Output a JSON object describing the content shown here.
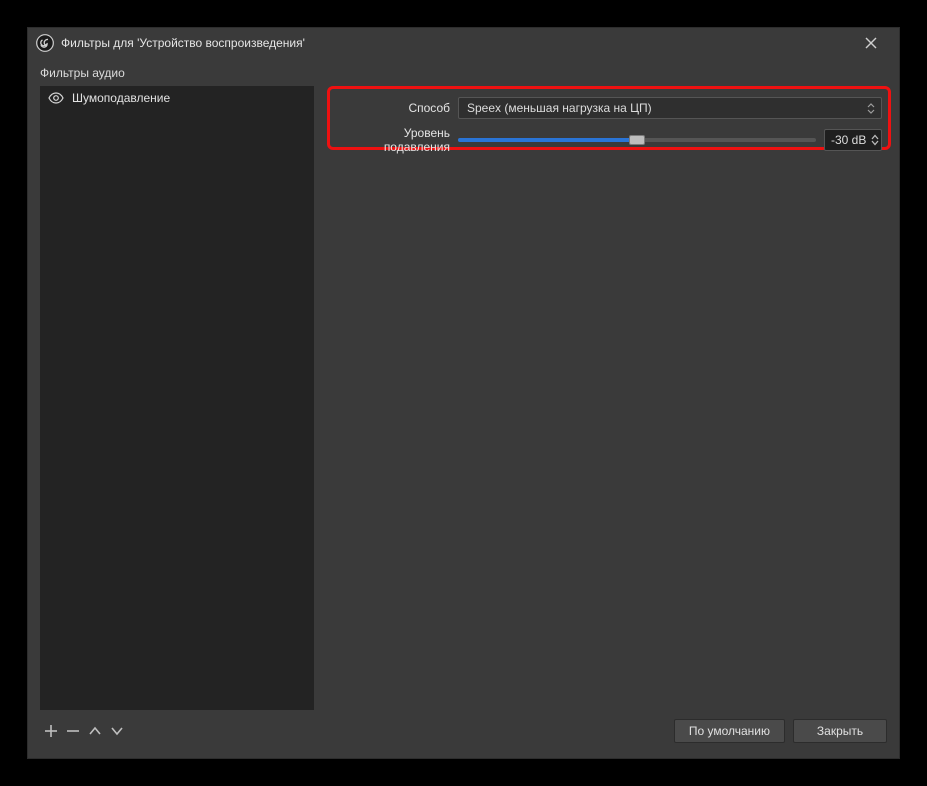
{
  "titlebar": {
    "title": "Фильтры для 'Устройство воспроизведения'"
  },
  "section": {
    "label": "Фильтры аудио"
  },
  "filters": {
    "items": [
      {
        "name": "Шумоподавление",
        "visible": true
      }
    ]
  },
  "properties": {
    "method": {
      "label": "Способ",
      "value": "Speex (меньшая нагрузка на ЦП)"
    },
    "suppression": {
      "label": "Уровень подавления",
      "value_display": "-30 dB",
      "value": -30,
      "min": -60,
      "max": 0,
      "fill_pct": 50
    }
  },
  "buttons": {
    "defaults": "По умолчанию",
    "close": "Закрыть"
  },
  "colors": {
    "highlight_border": "#e11",
    "slider_fill": "#2a74d6"
  }
}
